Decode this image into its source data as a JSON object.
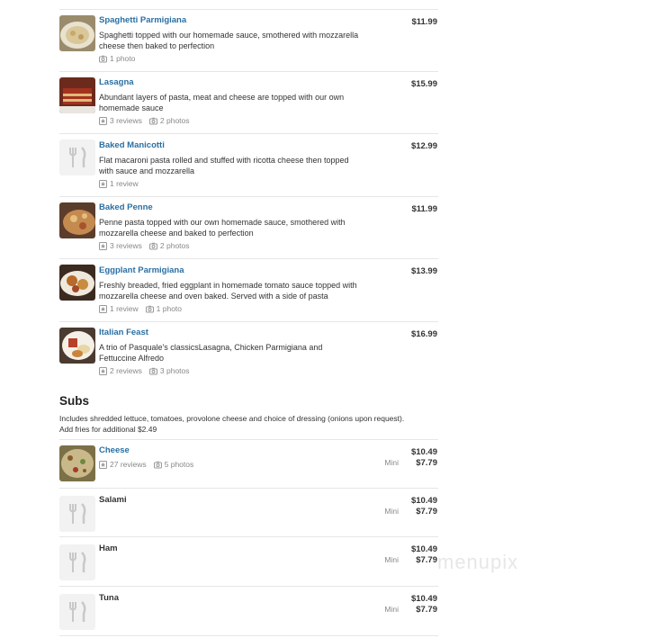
{
  "colors": {
    "link": "#2a6fa3",
    "text": "#333333",
    "muted": "#888888",
    "divider": "#e6e6e6"
  },
  "entrees": [
    {
      "name": "Spaghetti Parmigiana",
      "desc": "Spaghetti topped with our homemade sauce, smothered with mozzarella cheese then baked to perfection",
      "reviews": "",
      "photos": "1 photo",
      "price": "$11.99",
      "thumb": "food-photo"
    },
    {
      "name": "Lasagna",
      "desc": "Abundant layers of pasta, meat and cheese are topped with our own homemade sauce",
      "reviews": "3 reviews",
      "photos": "2 photos",
      "price": "$15.99",
      "thumb": "food-photo"
    },
    {
      "name": "Baked Manicotti",
      "desc": "Flat macaroni pasta rolled and stuffed with ricotta cheese then topped with sauce and mozzarella",
      "reviews": "1 review",
      "photos": "",
      "price": "$12.99",
      "thumb": "placeholder"
    },
    {
      "name": "Baked Penne",
      "desc": "Penne pasta topped with our own homemade sauce, smothered with mozzarella cheese and baked to perfection",
      "reviews": "3 reviews",
      "photos": "2 photos",
      "price": "$11.99",
      "thumb": "food-photo"
    },
    {
      "name": "Eggplant Parmigiana",
      "desc": "Freshly breaded, fried eggplant in homemade tomato sauce topped with mozzarella cheese and oven baked. Served with a side of pasta",
      "reviews": "1 review",
      "photos": "1 photo",
      "price": "$13.99",
      "thumb": "food-photo"
    },
    {
      "name": "Italian Feast",
      "desc": "A trio of Pasquale's classicsLasagna, Chicken Parmigiana and Fettuccine Alfredo",
      "reviews": "2 reviews",
      "photos": "3 photos",
      "price": "$16.99",
      "thumb": "food-photo"
    }
  ],
  "subs_section": {
    "title": "Subs",
    "desc": "Includes shredded lettuce, tomatoes, provolone cheese and choice of dressing (onions upon request). Add fries for additional $2.49"
  },
  "subs": [
    {
      "name": "Cheese",
      "reviews": "27 reviews",
      "photos": "5 photos",
      "price": "$10.49",
      "mini_label": "Mini",
      "mini_price": "$7.79",
      "thumb": "food-photo"
    },
    {
      "name": "Salami",
      "reviews": "",
      "photos": "",
      "price": "$10.49",
      "mini_label": "Mini",
      "mini_price": "$7.79",
      "thumb": "placeholder"
    },
    {
      "name": "Ham",
      "reviews": "",
      "photos": "",
      "price": "$10.49",
      "mini_label": "Mini",
      "mini_price": "$7.79",
      "thumb": "placeholder"
    },
    {
      "name": "Tuna",
      "reviews": "",
      "photos": "",
      "price": "$10.49",
      "mini_label": "Mini",
      "mini_price": "$7.79",
      "thumb": "placeholder"
    }
  ],
  "watermark": "menupix"
}
